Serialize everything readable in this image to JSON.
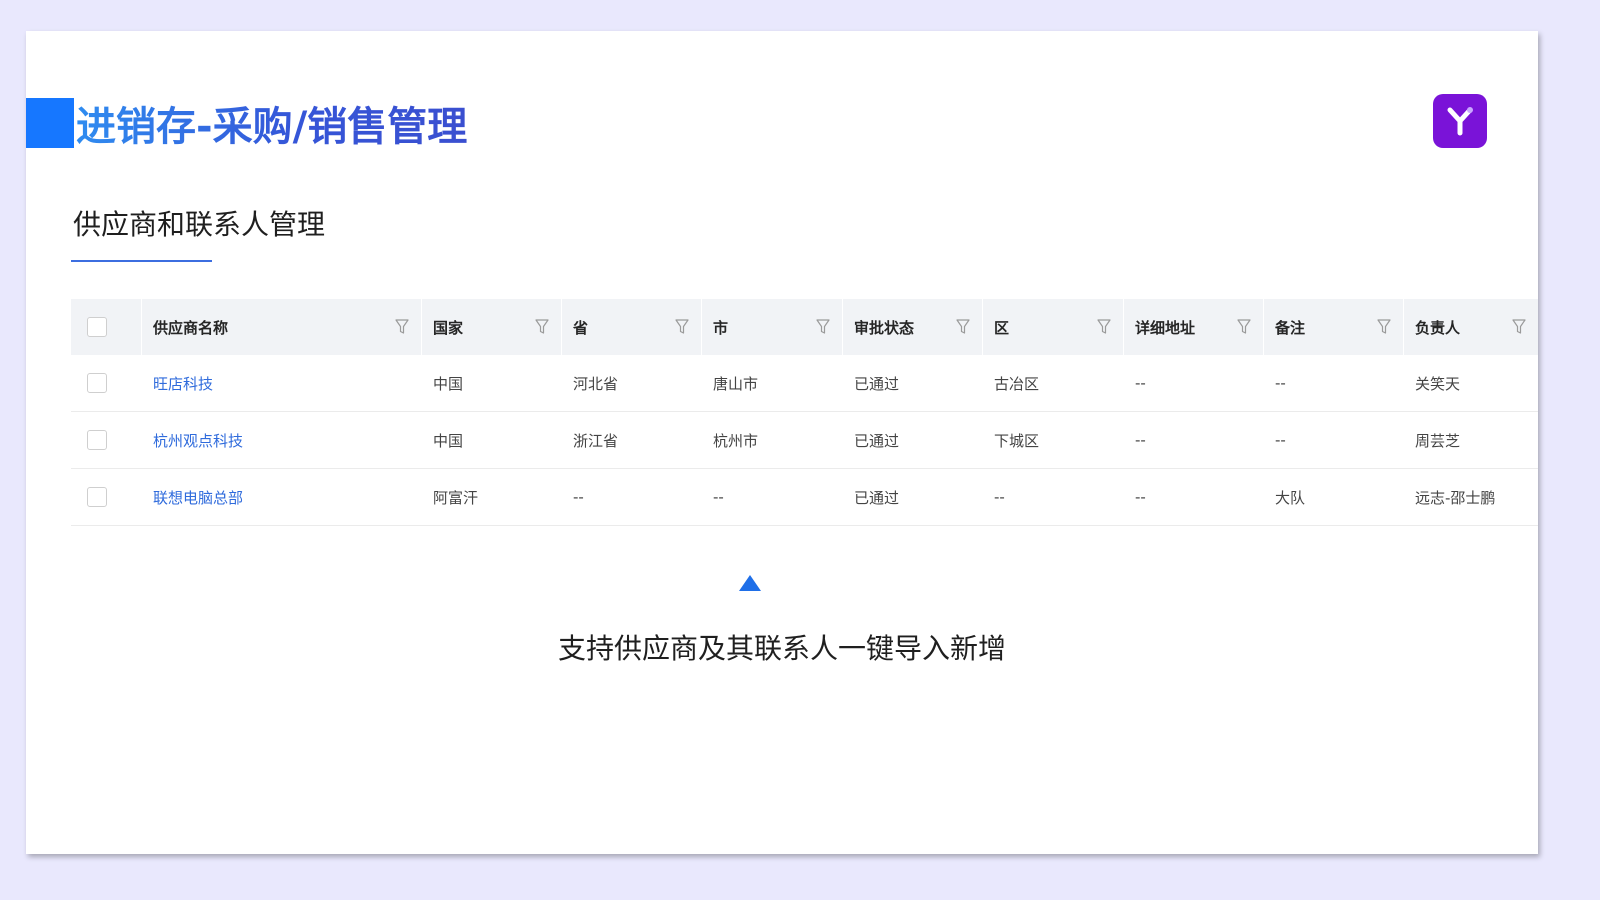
{
  "header": {
    "title": "进销存-采购/销售管理",
    "accent_color": "#1677ff",
    "logo_icon": "y-logo-icon",
    "logo_color": "#7a13d8"
  },
  "section": {
    "title": "供应商和联系人管理"
  },
  "table": {
    "columns": [
      "供应商名称",
      "国家",
      "省",
      "市",
      "审批状态",
      "区",
      "详细地址",
      "备注",
      "负责人"
    ],
    "rows": [
      [
        "旺店科技",
        "中国",
        "河北省",
        "唐山市",
        "已通过",
        "古冶区",
        "--",
        "--",
        "关笑天"
      ],
      [
        "杭州观点科技",
        "中国",
        "浙江省",
        "杭州市",
        "已通过",
        "下城区",
        "--",
        "--",
        "周芸芝"
      ],
      [
        "联想电脑总部",
        "阿富汗",
        "--",
        "--",
        "已通过",
        "--",
        "--",
        "大队",
        "远志-邵士鹏"
      ]
    ],
    "link_color": "#2f6bdc",
    "header_bg": "#f1f3f6"
  },
  "caption": {
    "text": "支持供应商及其联系人一键导入新增",
    "marker_color": "#1f6fe8"
  }
}
